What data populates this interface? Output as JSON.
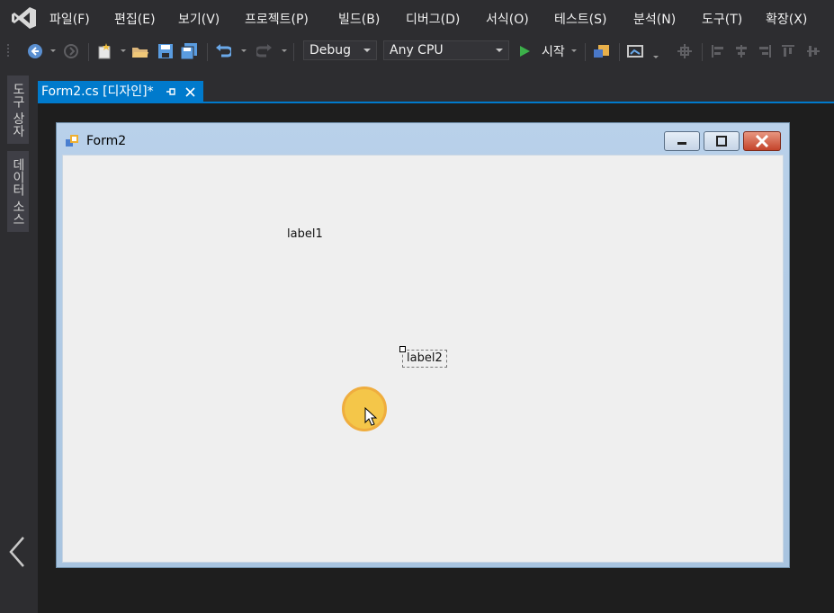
{
  "menu": {
    "items": [
      "파일(F)",
      "편집(E)",
      "보기(V)",
      "프로젝트(P)",
      "빌드(B)",
      "디버그(D)",
      "서식(O)",
      "테스트(S)",
      "분석(N)",
      "도구(T)",
      "확장(X)"
    ]
  },
  "toolbar": {
    "config_value": "Debug",
    "platform_value": "Any CPU",
    "start_label": "시작"
  },
  "left_dock": {
    "toolbox_label": "도구 상자",
    "datasource_label": "데이터 소스"
  },
  "document_tab": {
    "title": "Form2.cs [디자인]*"
  },
  "form": {
    "title": "Form2",
    "label1": "label1",
    "label2": "label2"
  },
  "colors": {
    "ide_background": "#2d2d30",
    "accent": "#007acc",
    "form_client": "#efefef",
    "cursor_highlight": "#f5c33b"
  }
}
